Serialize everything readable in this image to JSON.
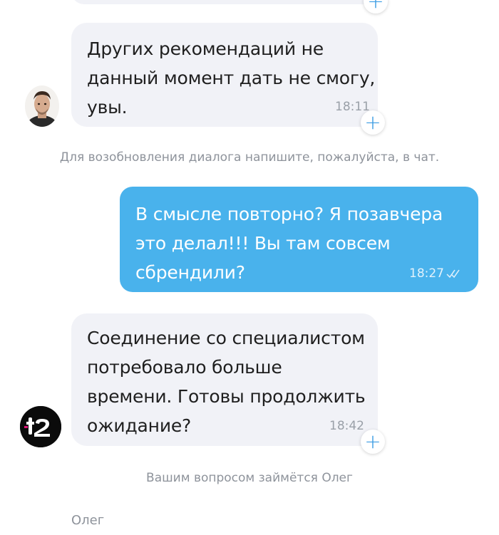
{
  "messages": [
    {
      "id": "bot-msg-1",
      "text": "",
      "time": ""
    },
    {
      "id": "bot-msg-2",
      "lines": [
        "Других рекомендаций не",
        "данный момент дать не смогу,",
        "увы."
      ],
      "time": "18:11"
    },
    {
      "id": "user-msg-1",
      "lines": [
        "В смысле повторно? Я позавчера",
        "это делал!!! Вы там совсем",
        "сбрендили?"
      ],
      "time": "18:27"
    },
    {
      "id": "bot-msg-3",
      "lines": [
        "Соединение со специалистом",
        "потребовало больше",
        "времени. Готовы продолжить",
        "ожидание?"
      ],
      "time": "18:42"
    }
  ],
  "system": {
    "resume_hint": "Для возобновления диалога напишите, пожалуйста, в чат.",
    "assigned": "Вашим вопросом займётся Олег"
  },
  "agent": {
    "name": "Олег"
  },
  "colors": {
    "user_bubble": "#49b2ec",
    "bot_bubble": "#f1f2f7",
    "accent": "#3a9be3"
  },
  "icons": {
    "add": "plus-icon",
    "read": "double-check-icon",
    "brand": "t2-logo"
  }
}
